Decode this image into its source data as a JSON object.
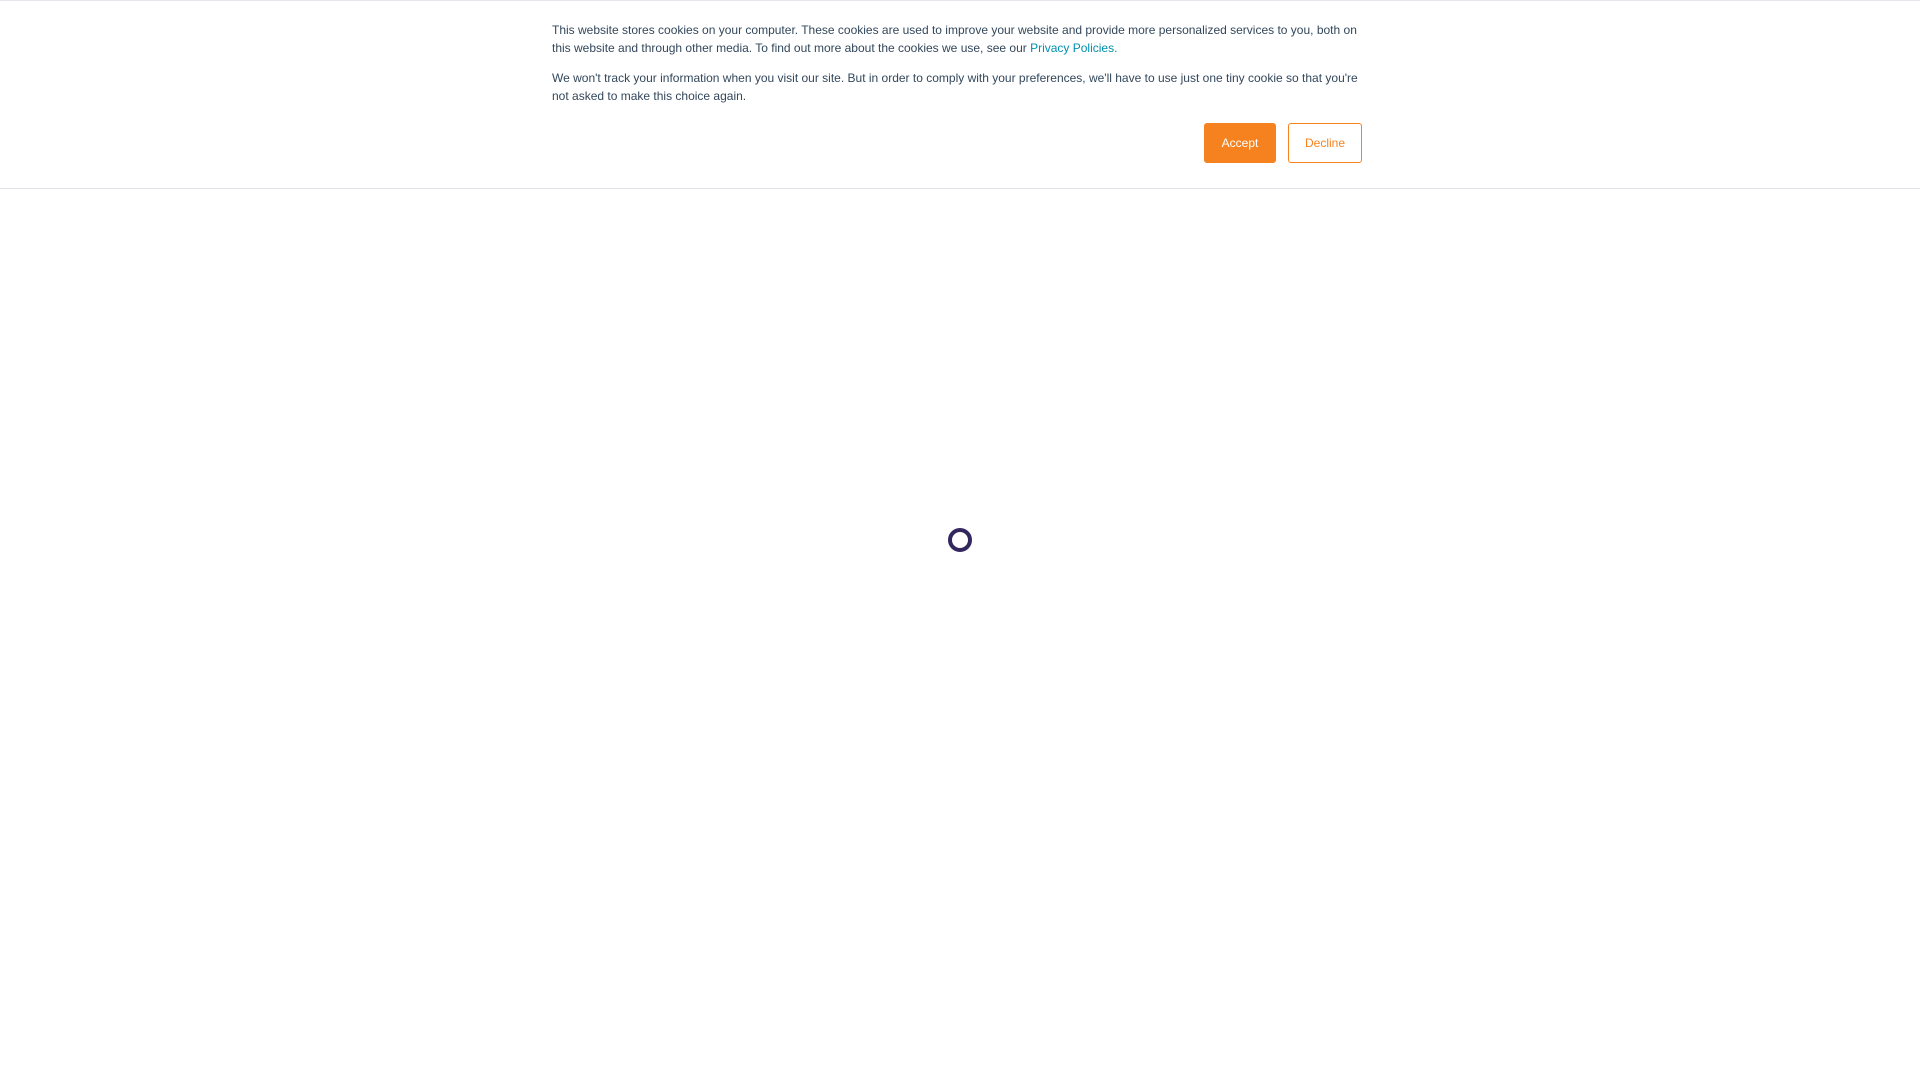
{
  "cookie_banner": {
    "paragraph_1": "This website stores cookies on your computer. These cookies are used to improve your website and provide more personalized services to you, both on this website and through other media. To find out more about the cookies we use, see our",
    "privacy_link": "Privacy Policies.",
    "paragraph_2": "We won't track your information when you visit our site. But in order to comply with your preferences, we'll have to use just one tiny cookie so that you're not asked to make this choice again.",
    "accept_label": "Accept",
    "decline_label": "Decline"
  },
  "loader": {
    "icon": "loading-spinner-icon",
    "color": "#33275e"
  },
  "colors": {
    "accent": "#f5821f",
    "link": "#0091ae",
    "text": "#33475b"
  }
}
